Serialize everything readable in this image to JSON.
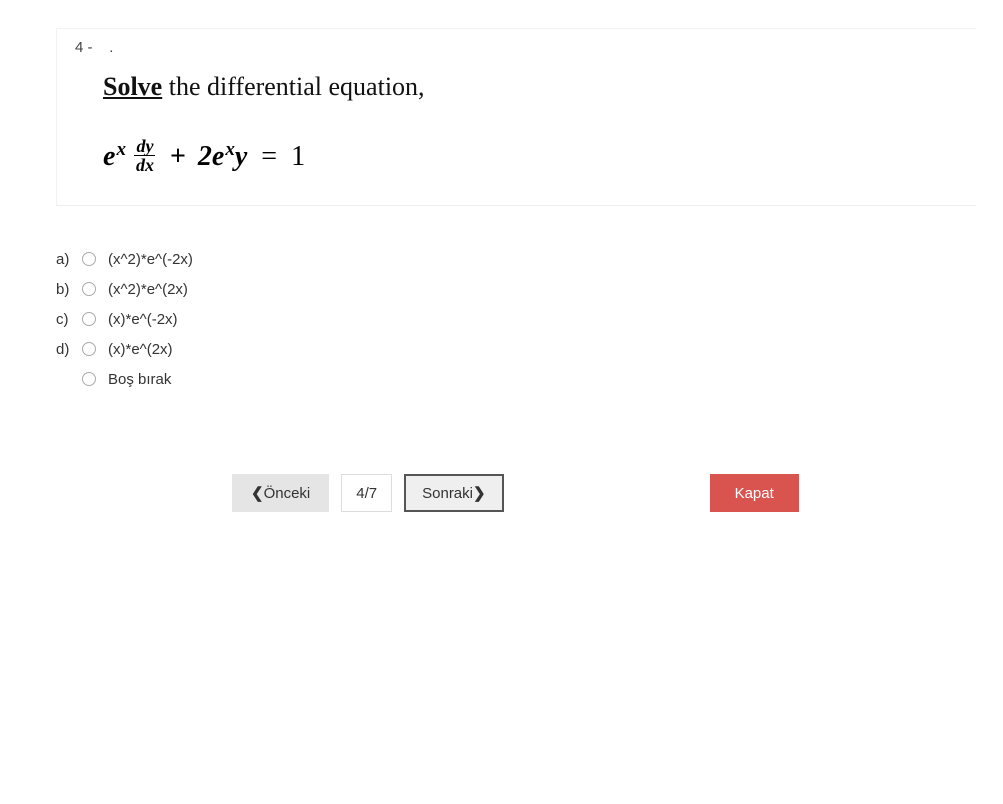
{
  "question": {
    "number": "4 -",
    "dot": ".",
    "prompt_solve": "Solve",
    "prompt_rest": " the differential equation,",
    "equation_text": "e^x (dy/dx) + 2 e^x y = 1"
  },
  "answers": [
    {
      "letter": "a)",
      "text": "(x^2)*e^(-2x)"
    },
    {
      "letter": "b)",
      "text": "(x^2)*e^(2x)"
    },
    {
      "letter": "c)",
      "text": "(x)*e^(-2x)"
    },
    {
      "letter": "d)",
      "text": "(x)*e^(2x)"
    },
    {
      "letter": "",
      "text": "Boş bırak"
    }
  ],
  "nav": {
    "prev_chev": "❮",
    "prev": "Önceki",
    "page": "4/7",
    "next": "Sonraki",
    "next_chev": "❯",
    "close": "Kapat"
  }
}
